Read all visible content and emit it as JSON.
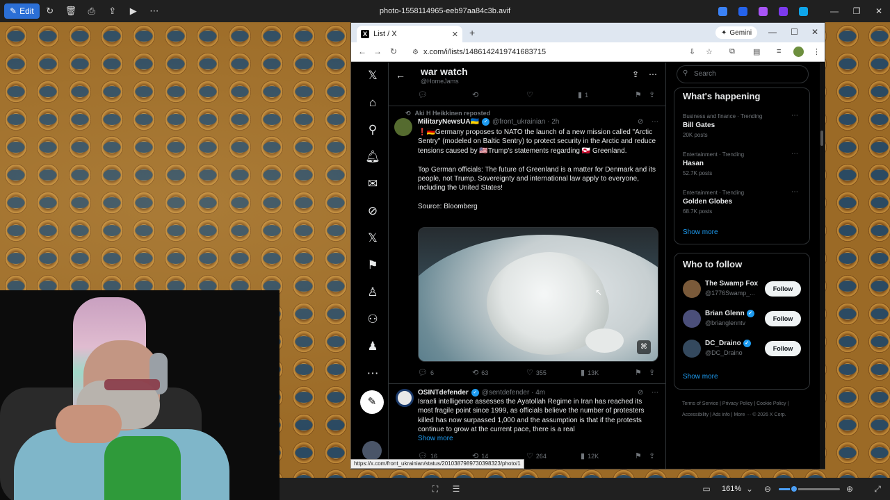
{
  "app": {
    "edit_label": "Edit",
    "file_title": "photo-1558114965-eeb97aa84c3b.avif",
    "toolbar_icons": [
      "rotate-icon",
      "delete-icon",
      "print-icon",
      "share-icon",
      "slideshow-icon",
      "more-icon"
    ],
    "tray_colors": [
      "#3b82f6",
      "#2563eb",
      "#a855f7",
      "#7c3aed",
      "#0ea5e9"
    ],
    "zoom": "161%"
  },
  "browser": {
    "tab_title": "List / X",
    "url": "x.com/i/lists/1486142419741683715",
    "gemini_label": "Gemini",
    "status_url": "https://x.com/front_ukrainian/status/2010387989730398323/photo/1"
  },
  "list": {
    "title": "war watch",
    "handle": "@HomeJams"
  },
  "prev_tweet": {
    "replies": "",
    "reposts": "",
    "likes": "",
    "views": "1"
  },
  "tweet1": {
    "repost_label": "Aki H Heikkinen reposted",
    "name": "MilitaryNewsUA🇺🇦",
    "handle": "@front_ukrainian · 2h",
    "text": "❗🇩🇪Germany proposes to NATO the launch of a new mission called \"Arctic Sentry\" (modeled on Baltic Sentry) to protect security in the Arctic and reduce tensions caused by 🇺🇸Trump's statements regarding 🇬🇱 Greenland.\n\nTop German officials: The future of Greenland is a matter for Denmark and its people, not Trump. Sovereignty and international law apply to everyone, including the United States!\n\nSource: Bloomberg",
    "replies": "6",
    "reposts": "63",
    "likes": "355",
    "views": "13K"
  },
  "tweet2": {
    "name": "OSINTdefender",
    "handle": "@sentdefender · 4m",
    "text": "Israeli intelligence assesses the Ayatollah Regime in Iran has reached its most fragile point since 1999, as officials believe the number of protesters killed has now surpassed 1,000 and the assumption is that if the protests continue to grow at the current pace, there is a real",
    "show_more": "Show more",
    "replies": "16",
    "reposts": "14",
    "likes": "264",
    "views": "12K"
  },
  "sidebar": {
    "search_placeholder": "Search",
    "happening_title": "What's happening",
    "trends": [
      {
        "category": "Business and finance · Trending",
        "name": "Bill Gates",
        "posts": "20K posts"
      },
      {
        "category": "Entertainment · Trending",
        "name": "Hasan",
        "posts": "52.7K posts"
      },
      {
        "category": "Entertainment · Trending",
        "name": "Golden Globes",
        "posts": "68.7K posts"
      }
    ],
    "show_more": "Show more",
    "wtf_title": "Who to follow",
    "follow_label": "Follow",
    "accounts": [
      {
        "name": "The Swamp Fox",
        "handle": "@1776Swamp_...",
        "verified": false
      },
      {
        "name": "Brian Glenn",
        "handle": "@brianglenntv",
        "verified": true
      },
      {
        "name": "DC_Draino",
        "handle": "@DC_Draino",
        "verified": true
      }
    ],
    "footer": "Terms of Service  |  Privacy Policy  |  Cookie Policy  |  Accessibility  |  Ads info  |  More ···  © 2026 X Corp."
  }
}
